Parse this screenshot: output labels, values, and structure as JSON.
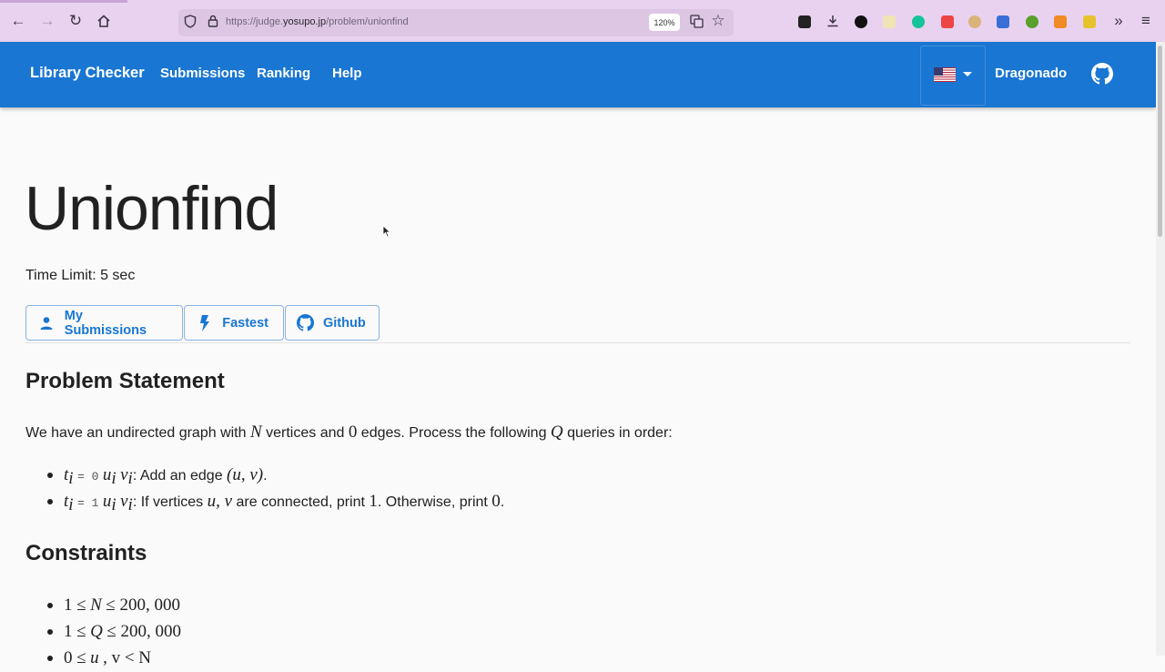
{
  "browser": {
    "url_prefix": "https://judge.",
    "url_domain": "yosupo.jp",
    "url_path": "/problem/unionfind",
    "zoom": "120%"
  },
  "header": {
    "brand": "Library Checker",
    "nav": [
      "Submissions",
      "Ranking",
      "Help"
    ],
    "user": "Dragonado",
    "color": "#1976d2"
  },
  "problem": {
    "title": "Unionfind",
    "time_limit": "Time Limit: 5 sec",
    "buttons": [
      "My Submissions",
      "Fastest",
      "Github"
    ]
  },
  "statement": {
    "heading": "Problem Statement",
    "intro": {
      "p1": "We have an undirected graph with",
      "N": "N",
      "p2": "vertices and",
      "zero": "0",
      "p3": "edges. Process the following",
      "Q": "Q",
      "p4": "queries in order:"
    },
    "queries": [
      {
        "t": "t",
        "i": "i",
        "eq": "= 0",
        "u": "u",
        "v": "v",
        "text1": ": Add an edge",
        "math": "(u, v)",
        "text2": "."
      },
      {
        "t": "t",
        "i": "i",
        "eq": "= 1",
        "u": "u",
        "v": "v",
        "text1": ": If vertices",
        "uv": "u, v",
        "text2": "are connected, print",
        "one": "1",
        "text3": ". Otherwise, print",
        "zero": "0",
        "text4": "."
      }
    ]
  },
  "constraints": {
    "heading": "Constraints",
    "items": [
      {
        "lo": "1 ≤",
        "var": "N",
        "hi": "≤ 200, 000"
      },
      {
        "lo": "1 ≤",
        "var": "Q",
        "hi": "≤ 200, 000"
      },
      {
        "lo": "0 ≤",
        "var": "u",
        "hi": ", v < N"
      }
    ]
  }
}
